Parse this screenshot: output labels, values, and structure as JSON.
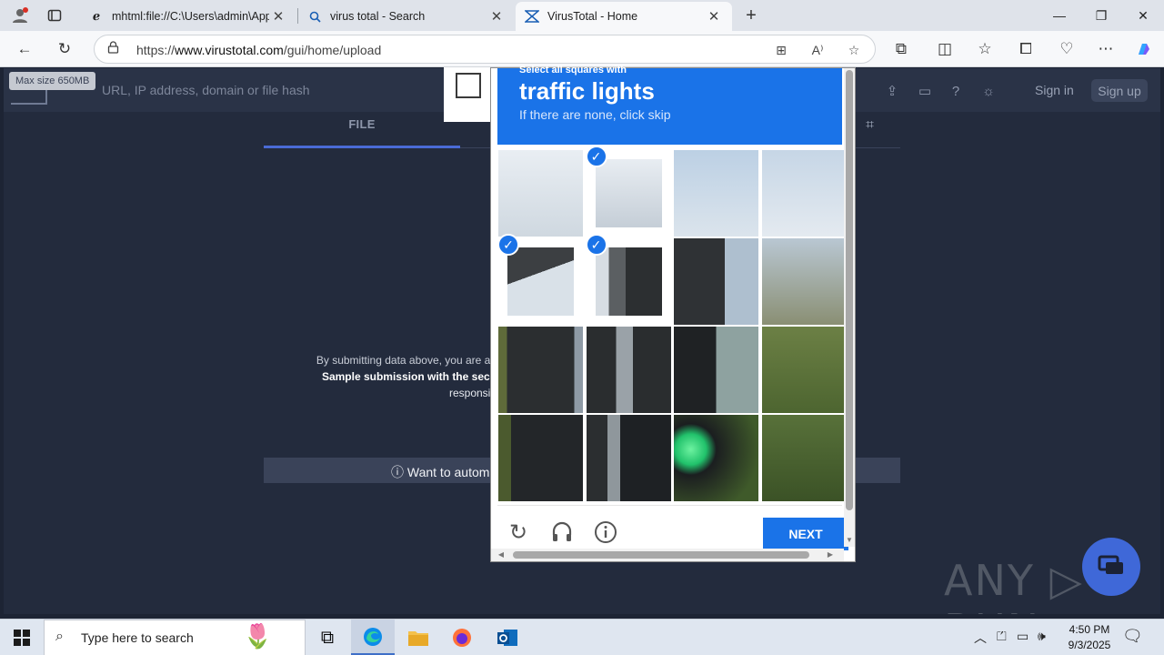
{
  "browser": {
    "tabs": [
      {
        "title": "mhtml:file://C:\\Users\\admin\\AppD",
        "favicon": "ie-icon",
        "active": false
      },
      {
        "title": "virus total - Search",
        "favicon": "search-icon",
        "active": false
      },
      {
        "title": "VirusTotal - Home",
        "favicon": "virustotal-icon",
        "active": true
      }
    ],
    "new_tab_label": "+",
    "address": {
      "prefix": "https://",
      "host": "www.virustotal.com",
      "path": "/gui/home/upload"
    }
  },
  "virustotal": {
    "max_size_tooltip": "Max size 650MB",
    "search_placeholder": "URL, IP address, domain or file hash",
    "signin_label": "Sign in",
    "signup_label": "Sign up",
    "tab_file_label": "FILE",
    "terms_line1": "By submitting data above, you are ag",
    "terms_line2": "Sample submission with the secu",
    "terms_line3": "responsib",
    "automate_label": "ⓘ Want to automa",
    "watermark": "ANY ▷ RUN"
  },
  "captcha": {
    "instruction_line1": "Select all squares with",
    "target": "traffic lights",
    "instruction_line3": "If there are none, click skip",
    "selected_cells": [
      1,
      4,
      5
    ],
    "next_label": "NEXT"
  },
  "taskbar": {
    "search_placeholder": "Type here to search",
    "time": "4:50 PM",
    "date": "9/3/2025"
  },
  "colors": {
    "captcha_blue": "#1a73e8",
    "vt_bg": "#232b3d",
    "vt_header": "#2a3347"
  }
}
